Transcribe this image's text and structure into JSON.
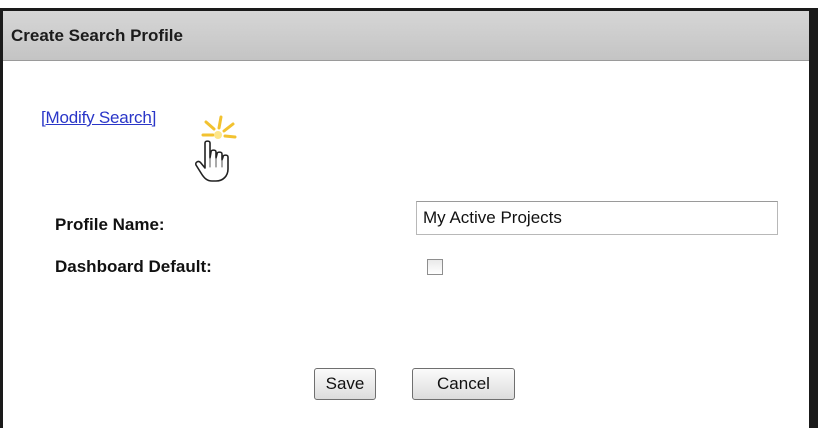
{
  "dialog": {
    "title": "Create Search Profile",
    "modify_link": "[Modify Search]"
  },
  "form": {
    "profile_name_label": "Profile Name:",
    "profile_name_value": "My Active Projects",
    "dashboard_default_label": "Dashboard Default:",
    "dashboard_default_checked": false
  },
  "buttons": {
    "save_label": "Save",
    "cancel_label": "Cancel"
  },
  "colors": {
    "link": "#2a36c8",
    "titlebar": "#cccccc",
    "border": "#1a1a1a",
    "highlight": "#f2c230"
  },
  "icons": {
    "cursor": "hand-pointer-icon",
    "click_effect": "click-burst-icon"
  }
}
